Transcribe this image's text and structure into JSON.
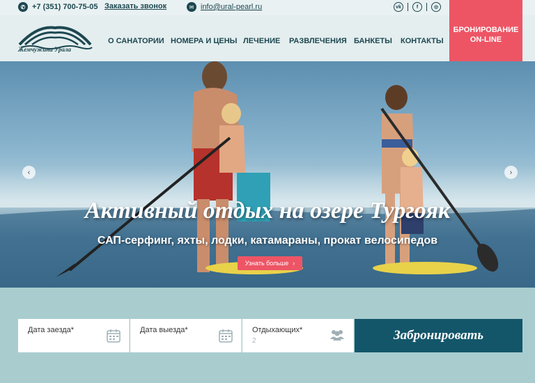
{
  "topbar": {
    "phone": "+7 (351) 700-75-05",
    "callback": "Заказать звонок",
    "email": "info@ural-pearl.ru",
    "socials": [
      "vk-icon",
      "facebook-icon",
      "instagram-icon"
    ]
  },
  "logo": {
    "text": "Жемчужина Урала"
  },
  "nav": {
    "items": [
      "О САНАТОРИИ",
      "НОМЕРА И ЦЕНЫ",
      "ЛЕЧЕНИЕ",
      "РАЗВЛЕЧЕНИЯ",
      "БАНКЕТЫ",
      "КОНТАКТЫ"
    ],
    "booking": "БРОНИРОВАНИЕ ON-LINE"
  },
  "hero": {
    "title": "Активный отдых на озере Тургояк",
    "subtitle": "САП-серфинг, яхты, лодки, катамараны, прокат велосипедов",
    "button": "Узнать больше"
  },
  "booking_form": {
    "checkin_label": "Дата заезда*",
    "checkout_label": "Дата выезда*",
    "guests_label": "Отдыхающих*",
    "guests_value": "2",
    "submit": "Забронировать"
  },
  "colors": {
    "primary": "#13566a",
    "accent": "#ed5565",
    "page_bg": "#a9cdcf"
  }
}
